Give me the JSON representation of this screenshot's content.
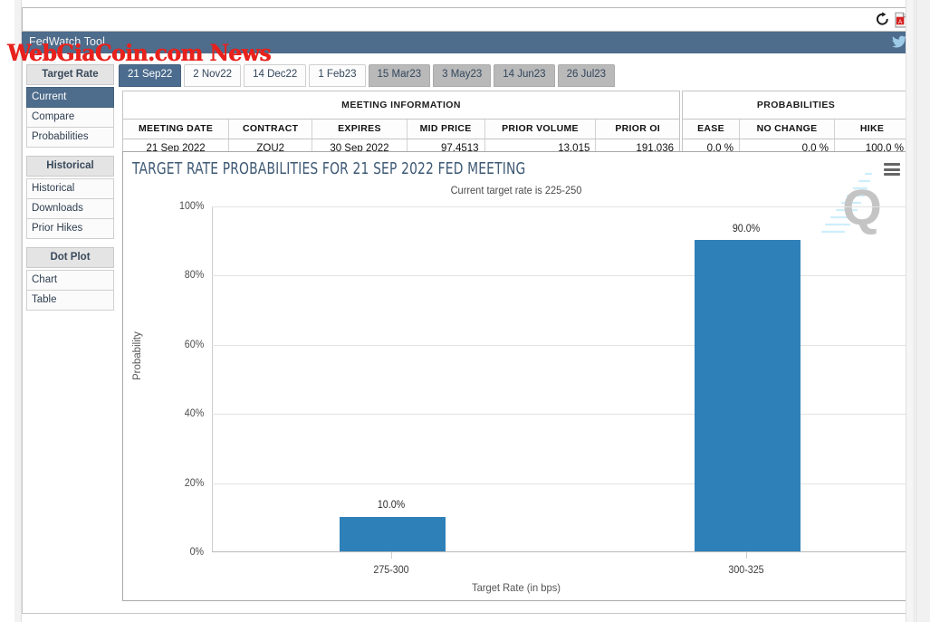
{
  "window": {
    "refresh_icon": "refresh-icon",
    "pdf_icon": "pdf-document-icon"
  },
  "header": {
    "title": "FedWatch Tool",
    "twitter_icon": "twitter-bird-icon",
    "background_color": "#4e6c8c"
  },
  "site_watermark": "WebGiaCoin.com News",
  "sidebar": {
    "groups": [
      {
        "heading": "Target Rate",
        "items": [
          {
            "label": "Current",
            "active": true
          },
          {
            "label": "Compare",
            "active": false
          },
          {
            "label": "Probabilities",
            "active": false
          }
        ]
      },
      {
        "heading": "Historical",
        "items": [
          {
            "label": "Historical",
            "active": false
          },
          {
            "label": "Downloads",
            "active": false
          },
          {
            "label": "Prior Hikes",
            "active": false
          }
        ]
      },
      {
        "heading": "Dot Plot",
        "items": [
          {
            "label": "Chart",
            "active": false
          },
          {
            "label": "Table",
            "active": false
          }
        ]
      }
    ]
  },
  "tabs": [
    {
      "label": "21 Sep22",
      "state": "active"
    },
    {
      "label": "2 Nov22",
      "state": "light"
    },
    {
      "label": "14 Dec22",
      "state": "light"
    },
    {
      "label": "1 Feb23",
      "state": "light"
    },
    {
      "label": "15 Mar23",
      "state": "gray"
    },
    {
      "label": "3 May23",
      "state": "gray"
    },
    {
      "label": "14 Jun23",
      "state": "gray"
    },
    {
      "label": "26 Jul23",
      "state": "gray"
    }
  ],
  "meeting_information": {
    "panel_title": "MEETING INFORMATION",
    "columns": [
      "MEETING DATE",
      "CONTRACT",
      "EXPIRES",
      "MID PRICE",
      "PRIOR VOLUME",
      "PRIOR OI"
    ],
    "row": {
      "meeting_date": "21 Sep 2022",
      "contract": "ZQU2",
      "expires": "30 Sep 2022",
      "mid_price": "97.4513",
      "prior_volume": "13,015",
      "prior_oi": "191,036"
    }
  },
  "probabilities": {
    "panel_title": "PROBABILITIES",
    "columns": [
      "EASE",
      "NO CHANGE",
      "HIKE"
    ],
    "row": {
      "ease": "0.0 %",
      "no_change": "0.0 %",
      "hike": "100.0 %"
    }
  },
  "chart_panel": {
    "menu_icon": "hamburger-menu-icon",
    "watermark_icon": "cme-q-logo-watermark"
  },
  "chart_data": {
    "type": "bar",
    "title": "TARGET RATE PROBABILITIES FOR 21 SEP 2022 FED MEETING",
    "subtitle": "Current target rate is 225-250",
    "categories": [
      "275-300",
      "300-325"
    ],
    "values": [
      10.0,
      90.0
    ],
    "data_labels": [
      "10.0%",
      "90.0%"
    ],
    "xlabel": "Target Rate (in bps)",
    "ylabel": "Probability",
    "ylim": [
      0,
      100
    ],
    "ytick_labels": [
      "0%",
      "20%",
      "40%",
      "60%",
      "80%",
      "100%"
    ],
    "ytick_values": [
      0,
      20,
      40,
      60,
      80,
      100
    ],
    "grid": true,
    "legend": false,
    "bar_color": "#2e80b8"
  }
}
